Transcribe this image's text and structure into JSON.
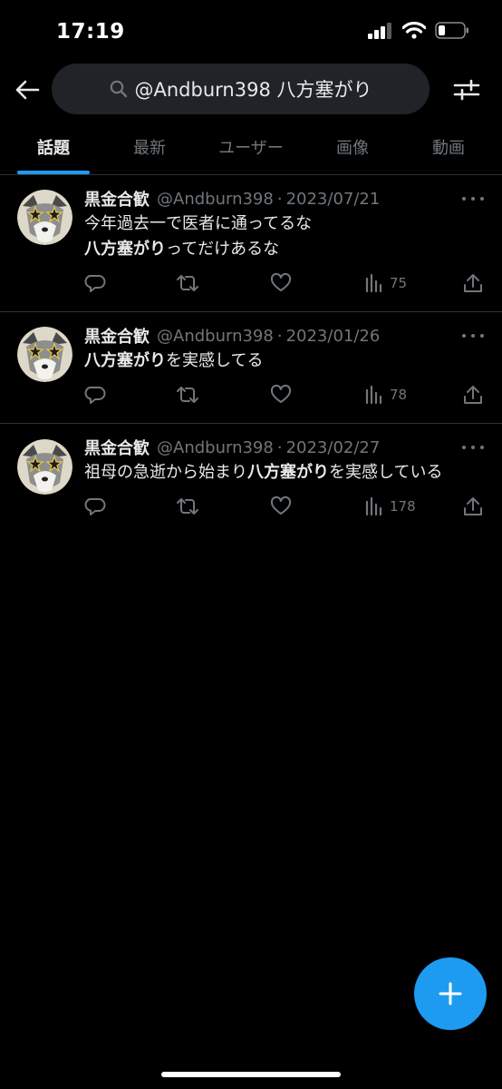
{
  "status_bar": {
    "time": "17:19"
  },
  "search": {
    "query": "@Andburn398 八方塞がり"
  },
  "tabs": [
    "話題",
    "最新",
    "ユーザー",
    "画像",
    "動画"
  ],
  "tweets": [
    {
      "name": "黒金合歓",
      "handle": "@Andburn398",
      "separator": "·",
      "date": "2023/07/21",
      "line1_pre": "今年過去一で医者に通ってるな",
      "line1_bold": "",
      "line1_post": "",
      "line2_bold": "八方塞がり",
      "line2_post": "ってだけあるな",
      "views": "75"
    },
    {
      "name": "黒金合歓",
      "handle": "@Andburn398",
      "separator": "·",
      "date": "2023/01/26",
      "line1_pre": "",
      "line1_bold": "八方塞がり",
      "line1_post": "を実感してる",
      "views": "78"
    },
    {
      "name": "黒金合歓",
      "handle": "@Andburn398",
      "separator": "·",
      "date": "2023/02/27",
      "line1_pre": "祖母の急逝から始まり",
      "line1_bold": "八方塞がり",
      "line1_post": "を実感している",
      "views": "178"
    }
  ],
  "icons": {
    "back": "arrow-left-icon",
    "search": "magnifier-icon",
    "filter": "sliders-icon",
    "reply": "speech-bubble-icon",
    "retweet": "retweet-arrows-icon",
    "like": "heart-icon",
    "views": "bar-chart-icon",
    "share": "share-upload-icon",
    "compose": "plus-icon"
  },
  "colors": {
    "accent": "#1d9bf0",
    "background": "#000000",
    "muted": "#71767b",
    "text": "#e7e9ea"
  }
}
